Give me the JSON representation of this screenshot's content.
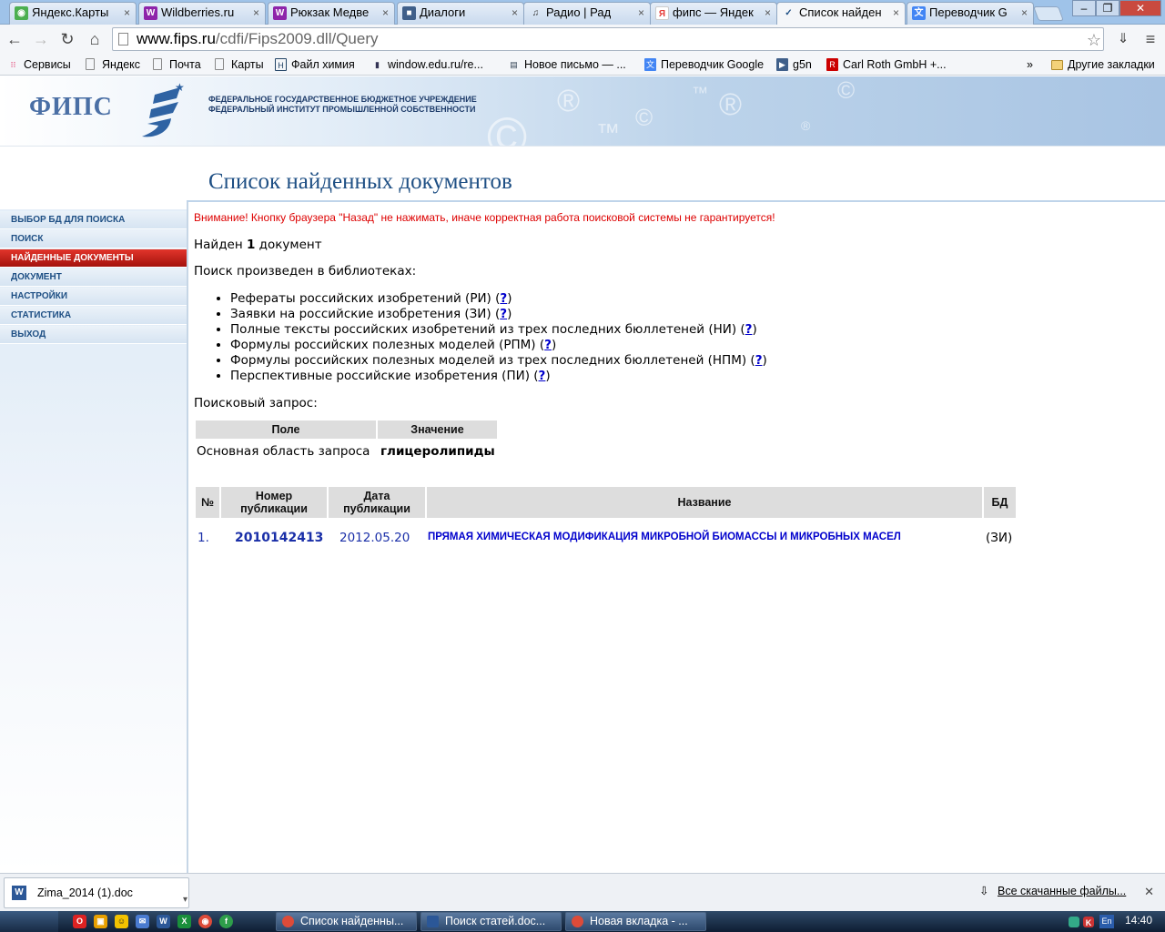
{
  "browser": {
    "tabs": [
      {
        "label": "Яндекс.Карты",
        "icon": "yandex-maps-icon",
        "color": "#4caf50",
        "glyph": "◉"
      },
      {
        "label": "Wildberries.ru",
        "icon": "wildberries-icon",
        "color": "#8e24aa",
        "glyph": "W"
      },
      {
        "label": "Рюкзак Медве",
        "icon": "wildberries-icon",
        "color": "#8e24aa",
        "glyph": "W"
      },
      {
        "label": "Диалоги",
        "icon": "vk-dialogs-icon",
        "color": "#3f5f8a",
        "glyph": "■"
      },
      {
        "label": "Радио | Рад",
        "icon": "music-note-icon",
        "color": "#333333",
        "glyph": "♫"
      },
      {
        "label": "фипс — Яндек",
        "icon": "yandex-icon",
        "color": "#e53935",
        "glyph": "Я"
      },
      {
        "label": "Список найден",
        "icon": "fips-icon",
        "color": "#1e4f84",
        "glyph": "✓"
      },
      {
        "label": "Переводчик G",
        "icon": "google-translate-icon",
        "color": "#4285f4",
        "glyph": "文"
      }
    ],
    "address": {
      "host": "www.fips.ru",
      "path": "/cdfi/Fips2009.dll/Query"
    },
    "bookmarks": [
      {
        "label": "Сервисы",
        "icon": "apps-grid-icon",
        "glyph": "⁝⁝"
      },
      {
        "label": "Яндекс",
        "icon": "page-icon",
        "glyph": ""
      },
      {
        "label": "Почта",
        "icon": "page-icon",
        "glyph": ""
      },
      {
        "label": "Карты",
        "icon": "page-icon",
        "glyph": ""
      },
      {
        "label": "Файл химия",
        "icon": "help-logo-icon",
        "glyph": "H"
      },
      {
        "label": "window.edu.ru/re...",
        "icon": "book-icon",
        "glyph": "▮"
      },
      {
        "label": "Новое письмо — ...",
        "icon": "mail-icon",
        "glyph": "▤"
      },
      {
        "label": "Переводчик Google",
        "icon": "google-translate-icon",
        "glyph": "文"
      },
      {
        "label": "g5n",
        "icon": "play-icon",
        "glyph": "▶"
      },
      {
        "label": "Carl Roth GmbH +...",
        "icon": "carl-roth-icon",
        "glyph": "R"
      }
    ],
    "bookmarks_more": "»",
    "other_bookmarks": "Другие закладки"
  },
  "header": {
    "logo_text": "ФИПС",
    "org_line1": "ФЕДЕРАЛЬНОЕ ГОСУДАРСТВЕННОЕ БЮДЖЕТНОЕ УЧРЕЖДЕНИЕ",
    "org_line2": "ФЕДЕРАЛЬНЫЙ ИНСТИТУТ ПРОМЫШЛЕННОЙ СОБСТВЕННОСТИ"
  },
  "page_title": "Список найденных документов",
  "sidebar": {
    "items": [
      {
        "label": "ВЫБОР БД ДЛЯ ПОИСКА",
        "active": false
      },
      {
        "label": "ПОИСК",
        "active": false
      },
      {
        "label": "НАЙДЕННЫЕ ДОКУМЕНТЫ",
        "active": true
      },
      {
        "label": "ДОКУМЕНТ",
        "active": false
      },
      {
        "label": "НАСТРОЙКИ",
        "active": false
      },
      {
        "label": "СТАТИСТИКА",
        "active": false
      },
      {
        "label": "ВЫХОД",
        "active": false
      }
    ]
  },
  "content": {
    "warning": "Внимание! Кнопку браузера \"Назад\" не нажимать, иначе корректная работа поисковой системы не гарантируется!",
    "found_prefix": "Найден",
    "found_count": "1",
    "found_suffix": "документ",
    "libraries_heading": "Поиск произведен в библиотеках:",
    "libraries": [
      "Рефераты российских изобретений (РИ)",
      "Заявки на российские изобретения (ЗИ)",
      "Полные тексты российских изобретений из трех последних бюллетеней (НИ)",
      "Формулы российских полезных моделей (РПМ)",
      "Формулы российских полезных моделей из трех последних бюллетеней (НПМ)",
      "Перспективные российские изобретения (ПИ)"
    ],
    "help_link": "?",
    "query_heading": "Поисковый запрос:",
    "query_table": {
      "col_field": "Поле",
      "col_value": "Значение",
      "field": "Основная область запроса",
      "value": "глицеролипиды"
    },
    "results_table": {
      "col_num": "№",
      "col_pubnum_1": "Номер",
      "col_pubnum_2": "публикации",
      "col_date_1": "Дата",
      "col_date_2": "публикации",
      "col_title": "Название",
      "col_db": "БД",
      "rows": [
        {
          "num": "1.",
          "pubnum": "2010142413",
          "date": "2012.05.20",
          "title": "ПРЯМАЯ ХИМИЧЕСКАЯ МОДИФИКАЦИЯ МИКРОБНОЙ БИОМАССЫ И МИКРОБНЫХ МАСЕЛ",
          "db": "(ЗИ)"
        }
      ]
    }
  },
  "downloads": {
    "file": "Zima_2014 (1).doc",
    "show_all": "Все скачанные файлы..."
  },
  "taskbar": {
    "windows": [
      {
        "label": "Список найденны...",
        "icon": "chrome-icon"
      },
      {
        "label": "Поиск статей.doc...",
        "icon": "word-icon"
      },
      {
        "label": "Новая вкладка - ...",
        "icon": "chrome-icon"
      }
    ],
    "lang": "En",
    "clock": "14:40"
  },
  "colors": {
    "accent": "#1e4f84",
    "active_menu": "#c0201a",
    "warning": "#dd0000",
    "link": "#0000cc"
  }
}
